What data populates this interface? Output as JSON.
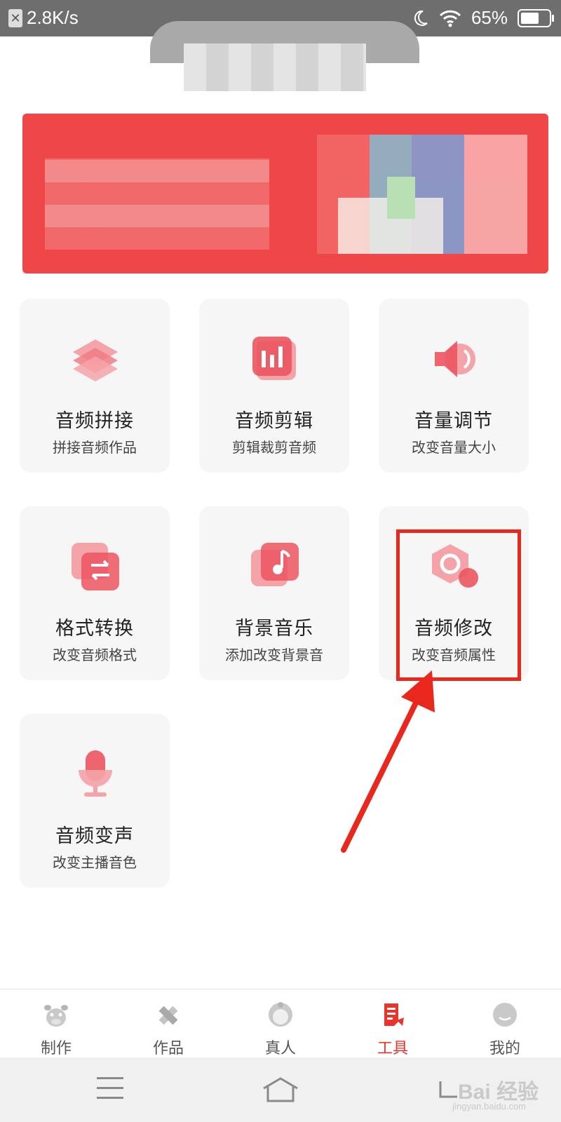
{
  "status_bar": {
    "speed": "2.8K/s",
    "battery_percent": "65%",
    "battery_level": 0.65
  },
  "tools": [
    {
      "title": "音频拼接",
      "desc": "拼接音频作品",
      "icon": "layers-icon"
    },
    {
      "title": "音频剪辑",
      "desc": "剪辑裁剪音频",
      "icon": "bar-chart-icon"
    },
    {
      "title": "音量调节",
      "desc": "改变音量大小",
      "icon": "speaker-icon"
    },
    {
      "title": "格式转换",
      "desc": "改变音频格式",
      "icon": "swap-icon"
    },
    {
      "title": "背景音乐",
      "desc": "添加改变背景音",
      "icon": "music-note-icon"
    },
    {
      "title": "音频修改",
      "desc": "改变音频属性",
      "icon": "settings-hexagon-icon"
    },
    {
      "title": "音频变声",
      "desc": "改变主播音色",
      "icon": "microphone-icon"
    }
  ],
  "highlighted_tool": "音频修改",
  "bottom_nav": [
    {
      "label": "制作",
      "icon": "cow-mascot-icon",
      "active": false
    },
    {
      "label": "作品",
      "icon": "pencil-ruler-icon",
      "active": false
    },
    {
      "label": "真人",
      "icon": "person-icon",
      "active": false
    },
    {
      "label": "工具",
      "icon": "document-tool-icon",
      "active": true
    },
    {
      "label": "我的",
      "icon": "smiley-face-icon",
      "active": false
    }
  ],
  "watermark": {
    "text": "Bai 经验",
    "url": "jingyan.baidu.com"
  },
  "colors": {
    "accent": "#e8352c",
    "icon_pink": "#f08a8f",
    "icon_red": "#ec5560",
    "highlight_box": "#e8281d",
    "banner_red": "#ef4747"
  }
}
